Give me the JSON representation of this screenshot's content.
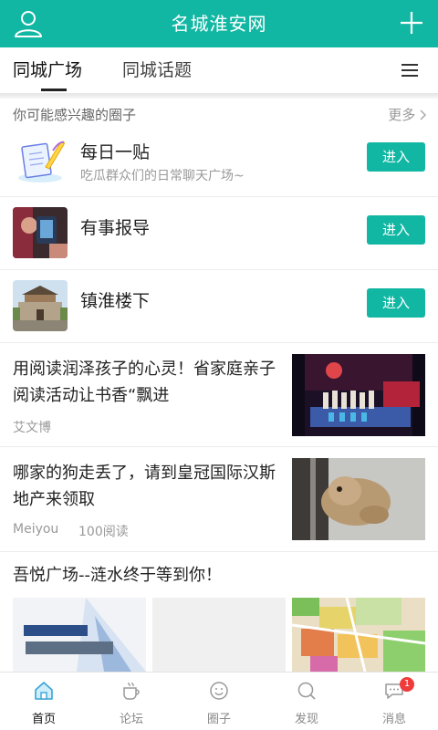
{
  "header": {
    "title": "名城淮安网"
  },
  "tabs": [
    {
      "label": "同城广场",
      "active": true
    },
    {
      "label": "同城话题",
      "active": false
    }
  ],
  "circles_section": {
    "label": "你可能感兴趣的圈子",
    "more": "更多"
  },
  "circles": [
    {
      "name": "每日一贴",
      "desc": "吃瓜群众们的日常聊天广场~",
      "button": "进入"
    },
    {
      "name": "有事报导",
      "desc": "",
      "button": "进入"
    },
    {
      "name": "镇淮楼下",
      "desc": "",
      "button": "进入"
    }
  ],
  "articles": [
    {
      "title": "用阅读润泽孩子的心灵！省家庭亲子阅读活动让书香“飘进",
      "author": "艾文博",
      "reads": ""
    },
    {
      "title": "哪家的狗走丢了，请到皇冠国际汉斯地产来领取",
      "author": "Meiyou",
      "reads": "100阅读"
    }
  ],
  "post3": {
    "title": "吾悦广场--涟水终于等到你！"
  },
  "bottom_nav": [
    {
      "label": "首页",
      "icon": "home-icon",
      "active": true
    },
    {
      "label": "论坛",
      "icon": "coffee-cup-icon",
      "active": false
    },
    {
      "label": "圈子",
      "icon": "smiley-circle-icon",
      "active": false
    },
    {
      "label": "发现",
      "icon": "search-icon",
      "active": false
    },
    {
      "label": "消息",
      "icon": "chat-bubble-icon",
      "active": false,
      "badge": "1"
    }
  ],
  "colors": {
    "accent": "#12b7a3",
    "badge": "#ee3b3b"
  }
}
